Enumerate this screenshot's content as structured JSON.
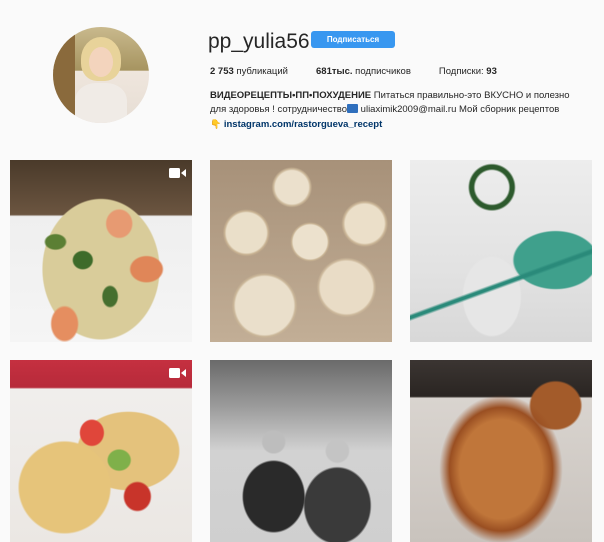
{
  "profile": {
    "username": "pp_yulia56",
    "follow_label": "Подписаться",
    "stats": {
      "posts_count": "2 753",
      "posts_label": " публикаций",
      "followers_count": "681тыс.",
      "followers_label": " подписчиков",
      "following_label": "Подписки: ",
      "following_count": "93"
    },
    "bio": {
      "name": "ВИДЕОРЕЦЕПТЫ•ПП•ПОХУДЕНИЕ",
      "line1_rest": " Питаться правильно-это ВКУСНО и полезно",
      "line2_a": "для здоровья ! сотрудничество",
      "line2_email": " uliaximik2009@mail.ru Мой сборник рецептов",
      "link": "instagram.com/rastorgueva_recept"
    }
  },
  "posts": [
    {
      "kind": "video",
      "icon": "video-icon"
    },
    {
      "kind": "photo"
    },
    {
      "kind": "photo"
    },
    {
      "kind": "video",
      "icon": "video-icon"
    },
    {
      "kind": "photo"
    },
    {
      "kind": "photo"
    }
  ],
  "colors": {
    "background": "#fafafa",
    "follow_button": "#3897f0",
    "link": "#003569"
  }
}
